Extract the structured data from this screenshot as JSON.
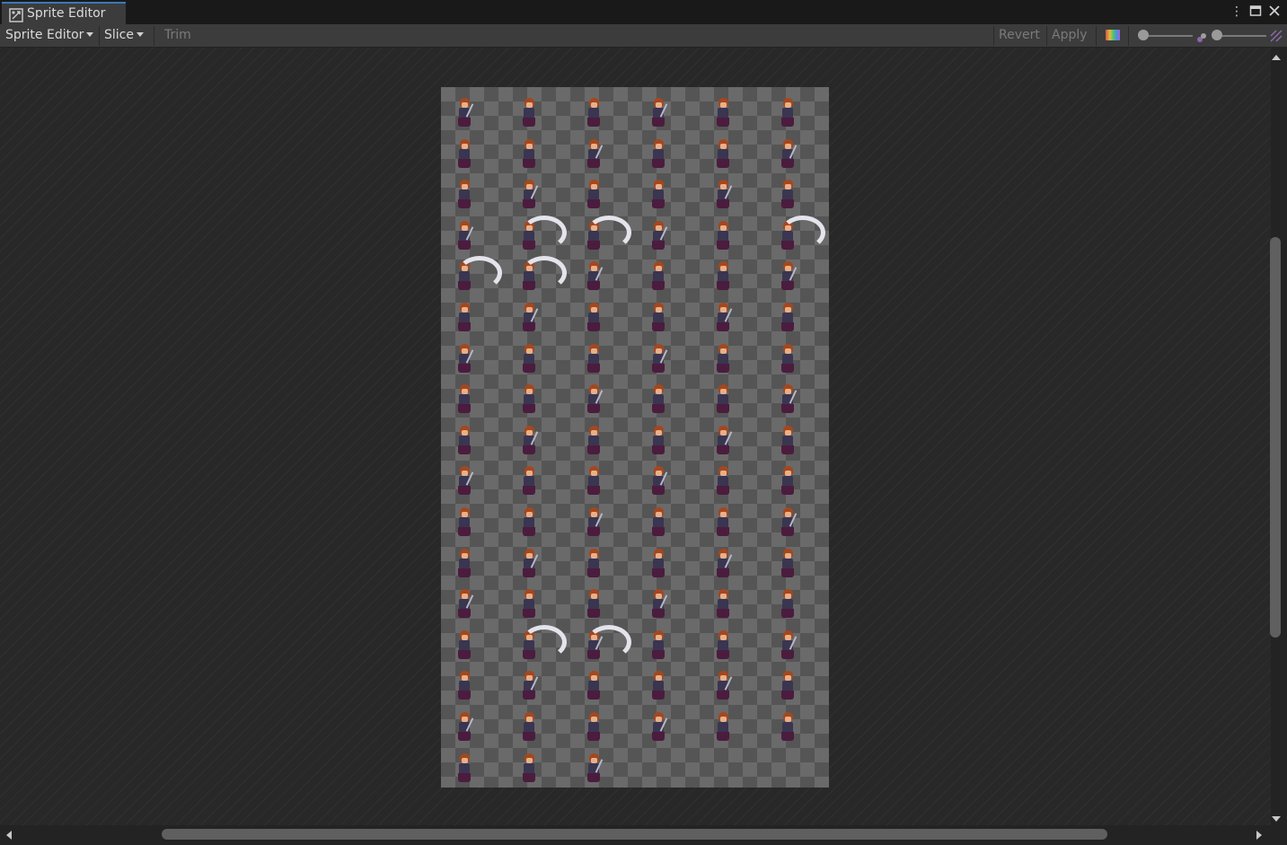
{
  "window": {
    "tab_title": "Sprite Editor",
    "icons": [
      "sprite-editor-icon",
      "more-options-icon",
      "maximize-icon",
      "close-icon"
    ]
  },
  "toolbar": {
    "mode_dropdown": "Sprite Editor",
    "slice_dropdown": "Slice",
    "trim_label": "Trim",
    "revert_label": "Revert",
    "apply_label": "Apply",
    "icons": [
      "color-channel-toggle-icon",
      "alpha-icon",
      "mip-level-icon"
    ]
  },
  "sprite_sheet": {
    "columns": 6,
    "rows": 17,
    "last_row_count": 3,
    "description_colors": {
      "hair": "#a4471e",
      "skin": "#e8b08a",
      "armor": "#3a3550",
      "skirt": "#4b1c3e",
      "slash": "#ebebf5"
    }
  },
  "colors": {
    "background": "#191919",
    "toolbar": "#3c3c3c",
    "viewport": "#282828",
    "tab_accent": "#3a79bb"
  }
}
